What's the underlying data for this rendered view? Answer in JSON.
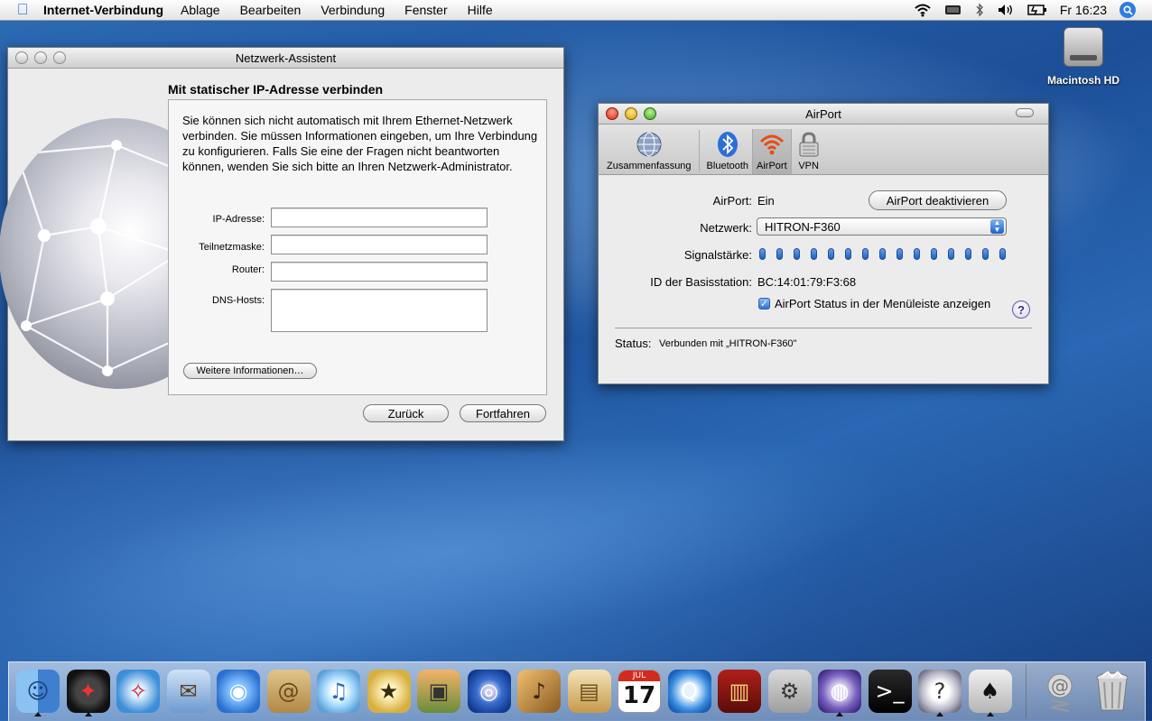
{
  "menubar": {
    "app_name": "Internet-Verbindung",
    "menus": [
      "Ablage",
      "Bearbeiten",
      "Verbindung",
      "Fenster",
      "Hilfe"
    ],
    "clock": "Fr 16:23",
    "status_icons": [
      "wifi-icon",
      "battery-meter-icon",
      "bluetooth-icon",
      "volume-icon",
      "battery-icon",
      "spotlight-icon"
    ]
  },
  "desktop": {
    "hd_label": "Macintosh HD"
  },
  "assistant": {
    "title": "Netzwerk-Assistent",
    "heading": "Mit statischer IP-Adresse verbinden",
    "intro": "Sie können sich nicht automatisch mit Ihrem Ethernet-Netzwerk verbinden. Sie müssen Informationen eingeben, um Ihre Verbindung zu konfigurieren. Falls Sie eine der Fragen nicht beantworten können, wenden Sie sich bitte an Ihren Netzwerk-Administrator.",
    "fields": {
      "ip_label": "IP-Adresse:",
      "ip_value": "",
      "mask_label": "Teilnetzmaske:",
      "mask_value": "",
      "router_label": "Router:",
      "router_value": "",
      "dns_label": "DNS-Hosts:",
      "dns_value": ""
    },
    "more_info_button": "Weitere Informationen…",
    "back_button": "Zurück",
    "continue_button": "Fortfahren"
  },
  "airport": {
    "title": "AirPort",
    "toolbar": {
      "summary": "Zusammenfassung",
      "bluetooth": "Bluetooth",
      "airport": "AirPort",
      "vpn": "VPN"
    },
    "airport_label": "AirPort:",
    "airport_value": "Ein",
    "toggle_button": "AirPort deaktivieren",
    "network_label": "Netzwerk:",
    "network_value": "HITRON-F360",
    "signal_label": "Signalstärke:",
    "signal_bars": 15,
    "base_id_label": "ID der Basisstation:",
    "base_id_value": "BC:14:01:79:F3:68",
    "show_status_checked": true,
    "show_status_label": "AirPort Status in der Menüleiste anzeigen",
    "status_label": "Status:",
    "status_value": "Verbunden mit „HITRON-F360\""
  },
  "dock": {
    "apps": [
      {
        "name": "finder-icon",
        "running": true
      },
      {
        "name": "dashboard-icon",
        "running": true
      },
      {
        "name": "safari-icon",
        "running": false
      },
      {
        "name": "mail-icon",
        "running": false
      },
      {
        "name": "ichat-icon",
        "running": false
      },
      {
        "name": "address-book-icon",
        "running": false
      },
      {
        "name": "itunes-icon",
        "running": false
      },
      {
        "name": "imovie-icon",
        "running": false
      },
      {
        "name": "iphoto-icon",
        "running": false
      },
      {
        "name": "idvd-icon",
        "running": false
      },
      {
        "name": "garageband-icon",
        "running": false
      },
      {
        "name": "iweb-icon",
        "running": false
      },
      {
        "name": "ical-icon",
        "running": false
      },
      {
        "name": "quicktime-icon",
        "running": false
      },
      {
        "name": "front-row-icon",
        "running": false
      },
      {
        "name": "system-preferences-icon",
        "running": false
      },
      {
        "name": "network-setup-icon",
        "running": true
      },
      {
        "name": "terminal-icon",
        "running": false
      },
      {
        "name": "help-icon",
        "running": true
      },
      {
        "name": "butler-icon",
        "running": true
      }
    ],
    "calendar_month": "JUL",
    "calendar_day": "17",
    "extras": [
      "mail-downloads-stack-icon",
      "trash-icon"
    ]
  }
}
